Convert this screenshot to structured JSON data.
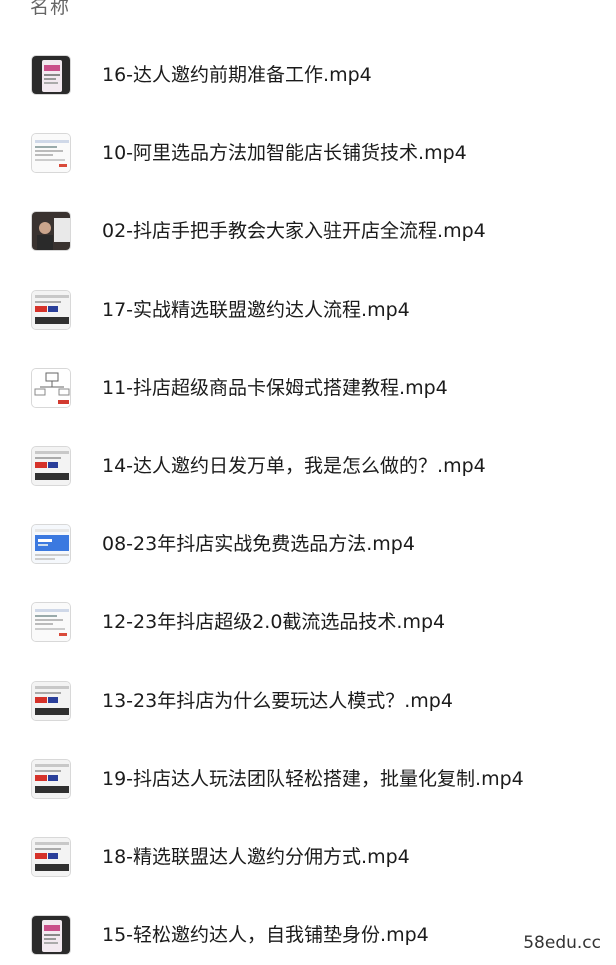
{
  "header": {
    "column_label": "名称"
  },
  "files": [
    {
      "name": "16-达人邀约前期准备工作.mp4",
      "thumb": "phone-screen-thumbnail"
    },
    {
      "name": "10-阿里选品方法加智能店长铺货技术.mp4",
      "thumb": "webpage-thumbnail"
    },
    {
      "name": "02-抖店手把手教会大家入驻开店全流程.mp4",
      "thumb": "presenter-thumbnail"
    },
    {
      "name": "17-实战精选联盟邀约达人流程.mp4",
      "thumb": "banner-thumbnail"
    },
    {
      "name": "11-抖店超级商品卡保姆式搭建教程.mp4",
      "thumb": "diagram-thumbnail"
    },
    {
      "name": "14-达人邀约日发万单，我是怎么做的？.mp4",
      "thumb": "banner-thumbnail"
    },
    {
      "name": "08-23年抖店实战免费选品方法.mp4",
      "thumb": "blue-webpage-thumbnail"
    },
    {
      "name": "12-23年抖店超级2.0截流选品技术.mp4",
      "thumb": "webpage-thumbnail"
    },
    {
      "name": "13-23年抖店为什么要玩达人模式？.mp4",
      "thumb": "banner-thumbnail"
    },
    {
      "name": "19-抖店达人玩法团队轻松搭建，批量化复制.mp4",
      "thumb": "banner-thumbnail"
    },
    {
      "name": "18-精选联盟达人邀约分佣方式.mp4",
      "thumb": "banner-thumbnail"
    },
    {
      "name": "15-轻松邀约达人，自我铺垫身份.mp4",
      "thumb": "phone-screen-thumbnail"
    }
  ],
  "watermark": "58edu.cc"
}
